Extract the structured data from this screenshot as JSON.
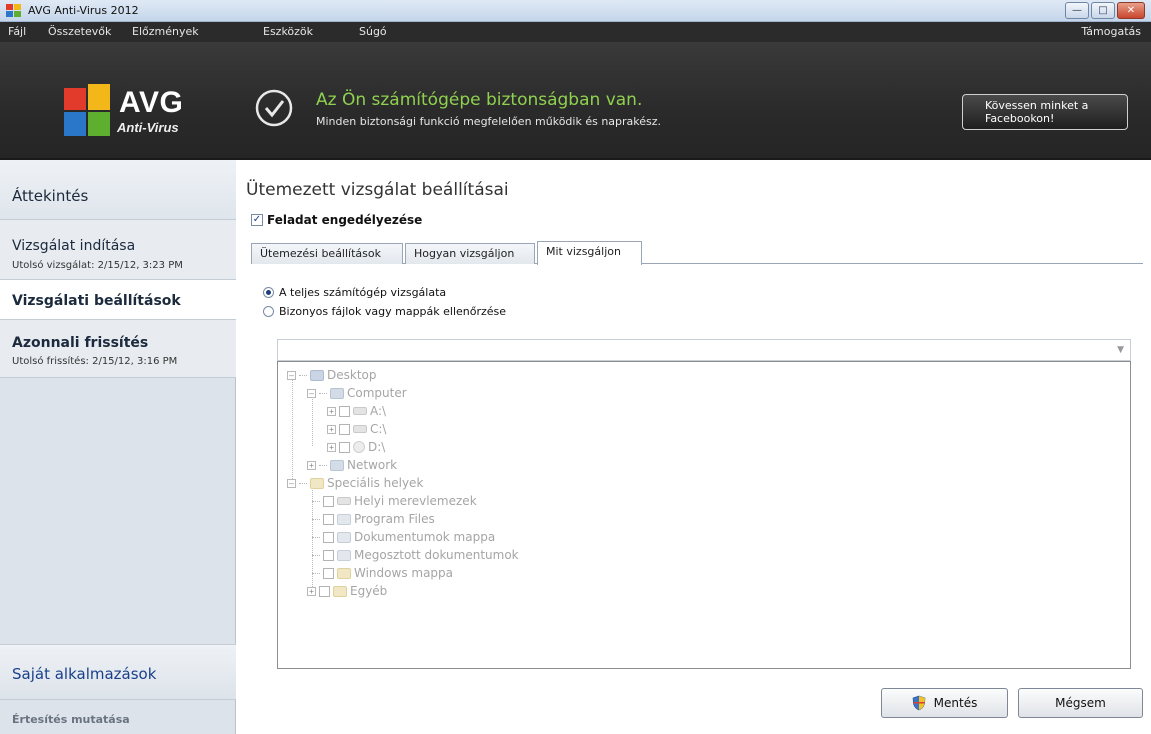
{
  "window": {
    "title": "AVG Anti-Virus 2012",
    "minimize_icon": "minimize-icon",
    "maximize_icon": "maximize-icon",
    "close_icon": "close-icon"
  },
  "menu": {
    "items": [
      "Fájl",
      "Összetevők",
      "Előzmények",
      "Eszközök",
      "Súgó"
    ],
    "support": "Támogatás"
  },
  "header": {
    "brand": "AVG",
    "product": "Anti-Virus",
    "status_title": "Az Ön számítógépe biztonságban van.",
    "status_sub": "Minden biztonsági funkció megfelelően működik és naprakész.",
    "facebook_button": [
      "Kövessen minket a",
      "Facebookon!"
    ],
    "status_color": "#8fd14f"
  },
  "sidebar": {
    "overview": "Áttekintés",
    "scan": {
      "label": "Vizsgálat indítása",
      "sub": "Utolsó vizsgálat: 2/15/12, 3:23 PM"
    },
    "settings": "Vizsgálati beállítások",
    "update": {
      "label": "Azonnali frissítés",
      "sub": "Utolsó frissítés: 2/15/12, 3:16 PM"
    },
    "apps": "Saját alkalmazások",
    "notify": "Értesítés mutatása"
  },
  "main": {
    "title": "Ütemezett vizsgálat beállításai",
    "enable_task": {
      "label": "Feladat engedélyezése",
      "checked": true
    },
    "tabs": [
      "Ütemezési beállítások",
      "Hogyan vizsgáljon",
      "Mit vizsgáljon"
    ],
    "active_tab": 2,
    "radios": [
      {
        "label": "A teljes számítógép vizsgálata",
        "selected": true
      },
      {
        "label": "Bizonyos fájlok vagy mappák ellenőrzése",
        "selected": false
      }
    ],
    "path_value": "",
    "tree": {
      "desktop": "Desktop",
      "computer": "Computer",
      "drive_a": "A:\\",
      "drive_c": "C:\\",
      "drive_d": "D:\\",
      "network": "Network",
      "special": "Speciális helyek",
      "special_items": [
        "Helyi merevlemezek",
        "Program Files",
        "Dokumentumok mappa",
        "Megosztott dokumentumok",
        "Windows mappa",
        "Egyéb"
      ]
    },
    "save_button": "Mentés",
    "cancel_button": "Mégsem"
  }
}
